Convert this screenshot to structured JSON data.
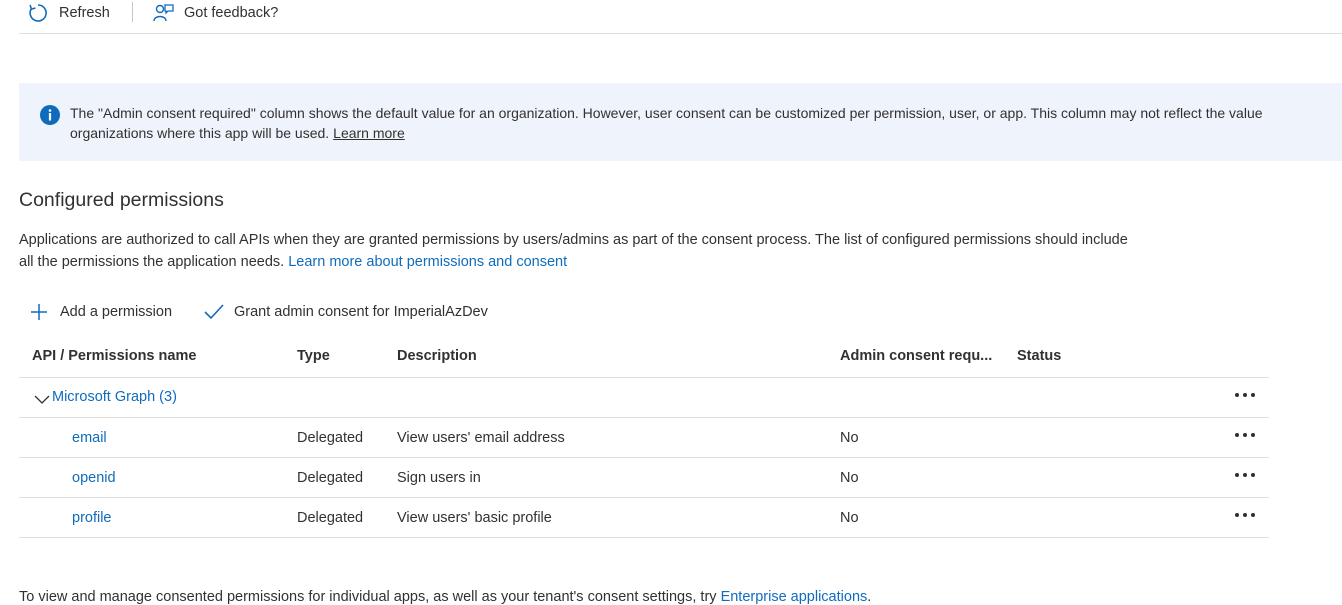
{
  "toolbar": {
    "refresh_label": "Refresh",
    "feedback_label": "Got feedback?"
  },
  "info_banner": {
    "line1": "The \"Admin consent required\" column shows the default value for an organization. However, user consent can be customized per permission, user, or app. This column may not reflect the value",
    "line2": "organizations where this app will be used.",
    "link": "Learn more"
  },
  "section": {
    "title": "Configured permissions",
    "description_line1": "Applications are authorized to call APIs when they are granted permissions by users/admins as part of the consent process. The list of configured permissions should include",
    "description_line2": "all the permissions the application needs.",
    "description_link": "Learn more about permissions and consent"
  },
  "commands": {
    "add_permission": "Add a permission",
    "grant_consent": "Grant admin consent for ImperialAzDev"
  },
  "table": {
    "columns": [
      "API / Permissions name",
      "Type",
      "Description",
      "Admin consent requ...",
      "Status"
    ],
    "group": {
      "name": "Microsoft Graph (3)"
    },
    "rows": [
      {
        "name": "email",
        "type": "Delegated",
        "description": "View users' email address",
        "admin_consent": "No",
        "status": ""
      },
      {
        "name": "openid",
        "type": "Delegated",
        "description": "Sign users in",
        "admin_consent": "No",
        "status": ""
      },
      {
        "name": "profile",
        "type": "Delegated",
        "description": "View users' basic profile",
        "admin_consent": "No",
        "status": ""
      }
    ]
  },
  "footer": {
    "text": "To view and manage consented permissions for individual apps, as well as your tenant's consent settings, try",
    "link": "Enterprise applications",
    "end": "."
  },
  "colors": {
    "accent": "#0f6cbd",
    "info_bg": "#eff4fc",
    "info_icon": "#0f6cbd",
    "text": "#323130",
    "border": "#e1dfdd"
  },
  "icons": [
    "refresh-icon",
    "feedback-icon",
    "info-icon",
    "plus-icon",
    "checkmark-icon",
    "chevron-down-icon",
    "more-icon"
  ]
}
